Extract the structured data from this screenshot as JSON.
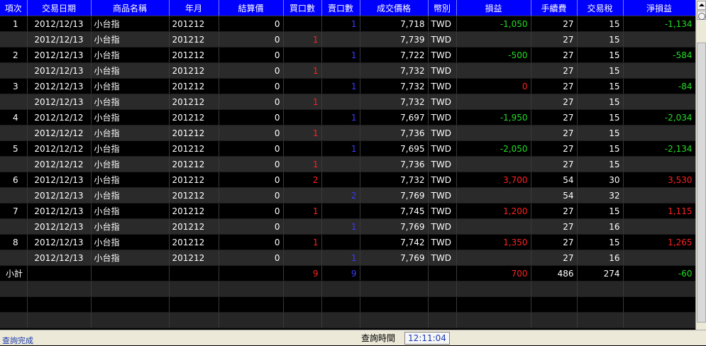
{
  "columns": [
    "項次",
    "交易日期",
    "商品名稱",
    "年月",
    "結算價",
    "買口數",
    "賣口數",
    "成交價格",
    "幣別",
    "損益",
    "手續費",
    "交易稅",
    "淨損益"
  ],
  "rows": [
    {
      "item": "1",
      "date": "2012/12/13",
      "product": "小台指",
      "month": "201212",
      "settle": "0",
      "buy": "",
      "sell": "1",
      "price": "7,718",
      "cur": "TWD",
      "pl": "-1,050",
      "fee": "27",
      "tax": "15",
      "net": "-1,134"
    },
    {
      "item": "",
      "date": "2012/12/13",
      "product": "小台指",
      "month": "201212",
      "settle": "0",
      "buy": "1",
      "sell": "",
      "price": "7,739",
      "cur": "TWD",
      "pl": "",
      "fee": "27",
      "tax": "15",
      "net": ""
    },
    {
      "item": "2",
      "date": "2012/12/13",
      "product": "小台指",
      "month": "201212",
      "settle": "0",
      "buy": "",
      "sell": "1",
      "price": "7,722",
      "cur": "TWD",
      "pl": "-500",
      "fee": "27",
      "tax": "15",
      "net": "-584"
    },
    {
      "item": "",
      "date": "2012/12/13",
      "product": "小台指",
      "month": "201212",
      "settle": "0",
      "buy": "1",
      "sell": "",
      "price": "7,732",
      "cur": "TWD",
      "pl": "",
      "fee": "27",
      "tax": "15",
      "net": ""
    },
    {
      "item": "3",
      "date": "2012/12/13",
      "product": "小台指",
      "month": "201212",
      "settle": "0",
      "buy": "",
      "sell": "1",
      "price": "7,732",
      "cur": "TWD",
      "pl": "0",
      "fee": "27",
      "tax": "15",
      "net": "-84"
    },
    {
      "item": "",
      "date": "2012/12/13",
      "product": "小台指",
      "month": "201212",
      "settle": "0",
      "buy": "1",
      "sell": "",
      "price": "7,732",
      "cur": "TWD",
      "pl": "",
      "fee": "27",
      "tax": "15",
      "net": ""
    },
    {
      "item": "4",
      "date": "2012/12/12",
      "product": "小台指",
      "month": "201212",
      "settle": "0",
      "buy": "",
      "sell": "1",
      "price": "7,697",
      "cur": "TWD",
      "pl": "-1,950",
      "fee": "27",
      "tax": "15",
      "net": "-2,034"
    },
    {
      "item": "",
      "date": "2012/12/12",
      "product": "小台指",
      "month": "201212",
      "settle": "0",
      "buy": "1",
      "sell": "",
      "price": "7,736",
      "cur": "TWD",
      "pl": "",
      "fee": "27",
      "tax": "15",
      "net": ""
    },
    {
      "item": "5",
      "date": "2012/12/12",
      "product": "小台指",
      "month": "201212",
      "settle": "0",
      "buy": "",
      "sell": "1",
      "price": "7,695",
      "cur": "TWD",
      "pl": "-2,050",
      "fee": "27",
      "tax": "15",
      "net": "-2,134"
    },
    {
      "item": "",
      "date": "2012/12/12",
      "product": "小台指",
      "month": "201212",
      "settle": "0",
      "buy": "1",
      "sell": "",
      "price": "7,736",
      "cur": "TWD",
      "pl": "",
      "fee": "27",
      "tax": "15",
      "net": ""
    },
    {
      "item": "6",
      "date": "2012/12/13",
      "product": "小台指",
      "month": "201212",
      "settle": "0",
      "buy": "2",
      "sell": "",
      "price": "7,732",
      "cur": "TWD",
      "pl": "3,700",
      "fee": "54",
      "tax": "30",
      "net": "3,530"
    },
    {
      "item": "",
      "date": "2012/12/13",
      "product": "小台指",
      "month": "201212",
      "settle": "0",
      "buy": "",
      "sell": "2",
      "price": "7,769",
      "cur": "TWD",
      "pl": "",
      "fee": "54",
      "tax": "32",
      "net": ""
    },
    {
      "item": "7",
      "date": "2012/12/13",
      "product": "小台指",
      "month": "201212",
      "settle": "0",
      "buy": "1",
      "sell": "",
      "price": "7,745",
      "cur": "TWD",
      "pl": "1,200",
      "fee": "27",
      "tax": "15",
      "net": "1,115"
    },
    {
      "item": "",
      "date": "2012/12/13",
      "product": "小台指",
      "month": "201212",
      "settle": "0",
      "buy": "",
      "sell": "1",
      "price": "7,769",
      "cur": "TWD",
      "pl": "",
      "fee": "27",
      "tax": "16",
      "net": ""
    },
    {
      "item": "8",
      "date": "2012/12/13",
      "product": "小台指",
      "month": "201212",
      "settle": "0",
      "buy": "1",
      "sell": "",
      "price": "7,742",
      "cur": "TWD",
      "pl": "1,350",
      "fee": "27",
      "tax": "15",
      "net": "1,265"
    },
    {
      "item": "",
      "date": "2012/12/13",
      "product": "小台指",
      "month": "201212",
      "settle": "0",
      "buy": "",
      "sell": "1",
      "price": "7,769",
      "cur": "TWD",
      "pl": "",
      "fee": "27",
      "tax": "16",
      "net": ""
    }
  ],
  "subtotal": {
    "label": "小計",
    "buy": "9",
    "sell": "9",
    "pl": "700",
    "fee": "486",
    "tax": "274",
    "net": "-60"
  },
  "status": {
    "text": "查詢完成",
    "query_label": "查詢時間",
    "query_time": "12:11:04"
  },
  "colors": {
    "header": "#0000ff",
    "profit": "#ff2020",
    "loss": "#22dd22",
    "buy": "#ff2020",
    "sell": "#3a3aff"
  }
}
